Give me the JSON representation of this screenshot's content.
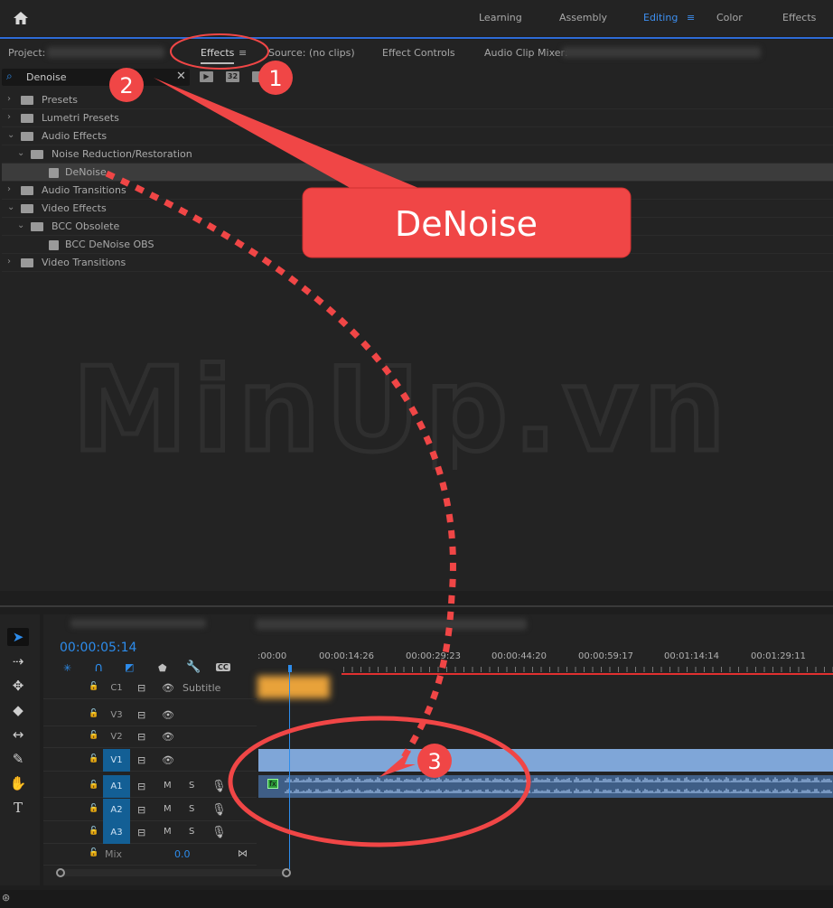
{
  "workspaces": {
    "items": [
      "Learning",
      "Assembly",
      "Editing",
      "Color",
      "Effects"
    ],
    "active": "Editing",
    "home_icon": "home-icon"
  },
  "panel_tabs": {
    "project": "Project:",
    "effects": "Effects",
    "source": "Source: (no clips)",
    "effect_controls": "Effect Controls",
    "audio_clip_mixer": "Audio Clip Mixer:"
  },
  "search": {
    "value": "Denoise"
  },
  "filter_icons": [
    "accelerated-effects-icon",
    "32-bit-icon",
    "yuv-icon"
  ],
  "filter_labels": {
    "bit32": "32"
  },
  "tree": [
    {
      "label": "Presets",
      "level": 0,
      "expanded": false,
      "icon": "preset-folder-icon"
    },
    {
      "label": "Lumetri Presets",
      "level": 0,
      "expanded": false,
      "icon": "preset-folder-icon"
    },
    {
      "label": "Audio Effects",
      "level": 0,
      "expanded": true,
      "icon": "folder-icon"
    },
    {
      "label": "Noise Reduction/Restoration",
      "level": 1,
      "expanded": true,
      "icon": "folder-icon"
    },
    {
      "label": "DeNoise",
      "level": 2,
      "selected": true,
      "icon": "audio-effect-icon"
    },
    {
      "label": "Audio Transitions",
      "level": 0,
      "expanded": false,
      "icon": "folder-icon"
    },
    {
      "label": "Video Effects",
      "level": 0,
      "expanded": true,
      "icon": "folder-icon"
    },
    {
      "label": "BCC Obsolete",
      "level": 1,
      "expanded": true,
      "icon": "folder-icon"
    },
    {
      "label": "BCC DeNoise OBS",
      "level": 2,
      "icon": "video-effect-icon"
    },
    {
      "label": "Video Transitions",
      "level": 0,
      "expanded": false,
      "icon": "folder-icon"
    }
  ],
  "watermark": "MinUp.vn",
  "annotations": {
    "callout": "DeNoise",
    "step1": "1",
    "step2": "2",
    "step3": "3",
    "color": "#f04646"
  },
  "timeline": {
    "timecode": "00:00:05:14",
    "ruler": [
      ":00:00",
      "00:00:14:26",
      "00:00:29:23",
      "00:00:44:20",
      "00:00:59:17",
      "00:01:14:14",
      "00:01:29:11"
    ],
    "tracks": {
      "c1": "C1",
      "subtitle": "Subtitle",
      "v3": "V3",
      "v2": "V2",
      "v1": "V1",
      "a1": "A1",
      "a2": "A2",
      "a3": "A3",
      "mix": "Mix",
      "mix_value": "0.0",
      "m": "M",
      "s": "S"
    },
    "fx_badge": "fx"
  },
  "colors": {
    "accent": "#2d8ceb",
    "track_target": "#135f95",
    "clip": "#7fa6d8"
  }
}
